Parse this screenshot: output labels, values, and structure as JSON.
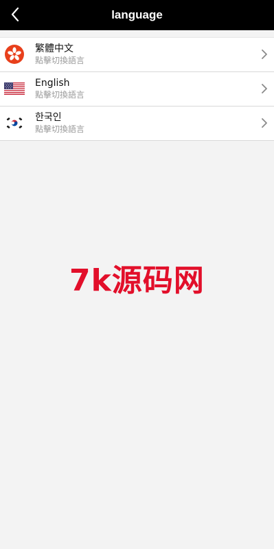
{
  "header": {
    "title": "language",
    "back_icon": "chevron-left-icon"
  },
  "languages": [
    {
      "label": "繁體中文",
      "subtitle": "點擊切換語言",
      "flag": "hong-kong-flag-icon"
    },
    {
      "label": "English",
      "subtitle": "點擊切換語言",
      "flag": "usa-flag-icon"
    },
    {
      "label": "한국인",
      "subtitle": "點擊切換語言",
      "flag": "south-korea-flag-icon"
    }
  ],
  "watermark": {
    "text": "7k源码网"
  },
  "colors": {
    "header_bg": "#000000",
    "watermark": "#e20f2a",
    "page_bg": "#f3f3f3"
  }
}
